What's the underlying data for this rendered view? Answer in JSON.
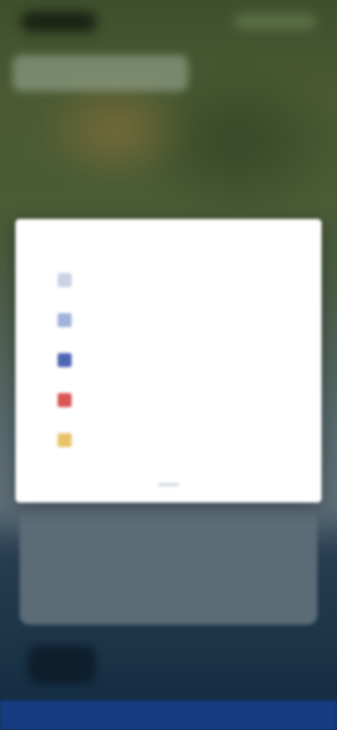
{
  "status_bar": {
    "time": "",
    "indicators": ""
  },
  "search": {
    "placeholder": ""
  },
  "dialog": {
    "title": "",
    "options": [
      {
        "label": "",
        "icon": "list-icon",
        "color": "#c9d3e3"
      },
      {
        "label": "",
        "icon": "document-icon",
        "color": "#9fb4d8"
      },
      {
        "label": "",
        "icon": "grid-icon",
        "color": "#4e67b5"
      },
      {
        "label": "",
        "icon": "flag-icon",
        "color": "#d95656"
      },
      {
        "label": "",
        "icon": "star-icon",
        "color": "#e8c36a"
      }
    ]
  },
  "colors": {
    "accent": "#173c82",
    "dialog_background": "#ffffff",
    "lower_sheet": "#5b6c77"
  }
}
